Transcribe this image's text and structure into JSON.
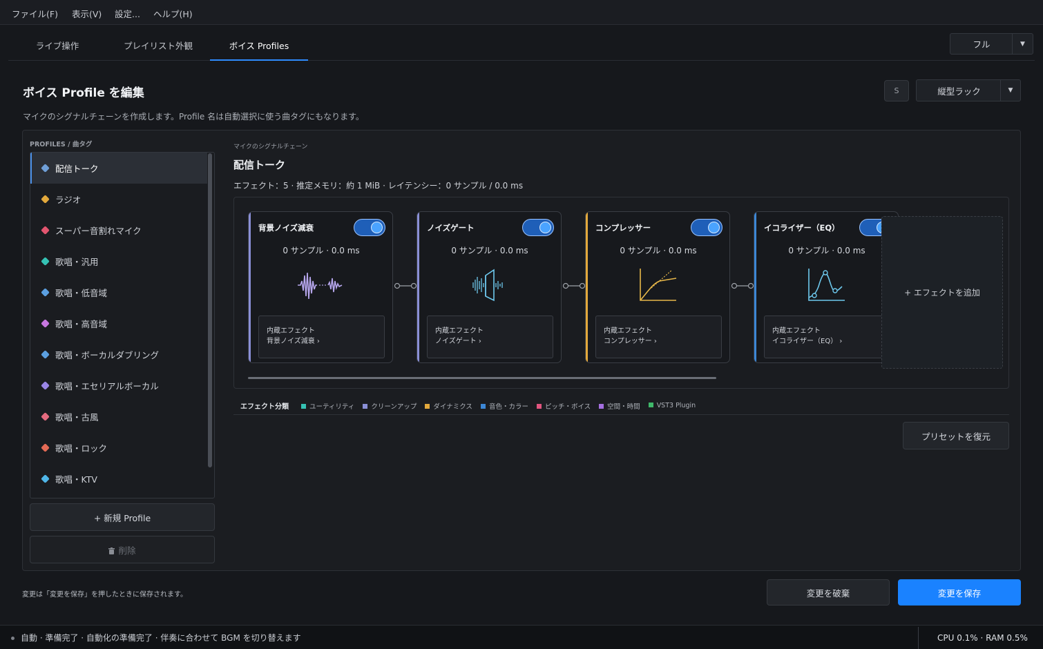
{
  "menu": [
    "ファイル(F)",
    "表示(V)",
    "設定...",
    "ヘルプ(H)"
  ],
  "tabs": [
    "ライブ操作",
    "プレイリスト外観",
    "ボイス Profiles"
  ],
  "view_mode": "フル",
  "page": {
    "title": "ボイス Profile を編集",
    "subtitle": "マイクのシグナルチェーンを作成します。Profile 名は自動選択に使う曲タグにもなります。",
    "s_button": "S",
    "layout_select": "縦型ラック"
  },
  "profiles": {
    "header": "PROFILES / 曲タグ",
    "items": [
      {
        "label": "配信トーク",
        "color": "#6f9fd8"
      },
      {
        "label": "ラジオ",
        "color": "#e3a93c"
      },
      {
        "label": "スーパー音割れマイク",
        "color": "#e2556f"
      },
      {
        "label": "歌唱・汎用",
        "color": "#35c2b4"
      },
      {
        "label": "歌唱・低音域",
        "color": "#5b9fe0"
      },
      {
        "label": "歌唱・高音域",
        "color": "#c777e0"
      },
      {
        "label": "歌唱・ボーカルダブリング",
        "color": "#5b9fe0"
      },
      {
        "label": "歌唱・エセリアルボーカル",
        "color": "#9a86e6"
      },
      {
        "label": "歌唱・古風",
        "color": "#e46b7f"
      },
      {
        "label": "歌唱・ロック",
        "color": "#e46a55"
      },
      {
        "label": "歌唱・KTV",
        "color": "#4fb6e8"
      }
    ],
    "new_button": "+ 新規 Profile",
    "delete_button": "削除"
  },
  "chain": {
    "caption": "マイクのシグナルチェーン",
    "title": "配信トーク",
    "stats": "エフェクト：5 · 推定メモリ：約 1 MiB · レイテンシー：0 サンプル / 0.0 ms",
    "effects": [
      {
        "name": "背景ノイズ減衰",
        "latency": "0 サンプル · 0.0 ms",
        "info_line1": "内蔵エフェクト",
        "info_line2": "背景ノイズ減衰 ›",
        "accent": "#8a8fd6",
        "icon": "waveform-icon",
        "enabled": true
      },
      {
        "name": "ノイズゲート",
        "latency": "0 サンプル · 0.0 ms",
        "info_line1": "内蔵エフェクト",
        "info_line2": "ノイズゲート ›",
        "accent": "#8a8fd6",
        "icon": "noise-gate-icon",
        "enabled": true
      },
      {
        "name": "コンプレッサー",
        "latency": "0 サンプル · 0.0 ms",
        "info_line1": "内蔵エフェクト",
        "info_line2": "コンプレッサー ›",
        "accent": "#e3a93c",
        "icon": "compressor-curve-icon",
        "enabled": true
      },
      {
        "name": "イコライザー（EQ）",
        "latency": "0 サンプル · 0.0 ms",
        "info_line1": "内蔵エフェクト",
        "info_line2": "イコライザー（EQ） ›",
        "accent": "#3c87d6",
        "icon": "eq-curve-icon",
        "enabled": true
      }
    ],
    "add_effect": "+ エフェクトを追加"
  },
  "legend": {
    "title": "エフェクト分類",
    "items": [
      {
        "label": "ユーティリティ",
        "color": "#35c2b4"
      },
      {
        "label": "クリーンアップ",
        "color": "#8a8fd6"
      },
      {
        "label": "ダイナミクス",
        "color": "#e3a93c"
      },
      {
        "label": "音色・カラー",
        "color": "#3c87d6"
      },
      {
        "label": "ピッチ・ボイス",
        "color": "#e2557f"
      },
      {
        "label": "空間・時間",
        "color": "#a46fe0"
      },
      {
        "label": "VST3 Plugin",
        "color": "#3fb86a"
      }
    ]
  },
  "restore_preset": "プリセットを復元",
  "footnote": "変更は「変更を保存」を押したときに保存されます。",
  "discard_button": "変更を破棄",
  "save_button": "変更を保存",
  "status": {
    "text": "自動 · 準備完了 · 自動化の準備完了 · 伴奏に合わせて BGM を切り替えます",
    "resources": "CPU 0.1% · RAM 0.5%"
  },
  "colors": {
    "accent": "#1a82ff"
  }
}
